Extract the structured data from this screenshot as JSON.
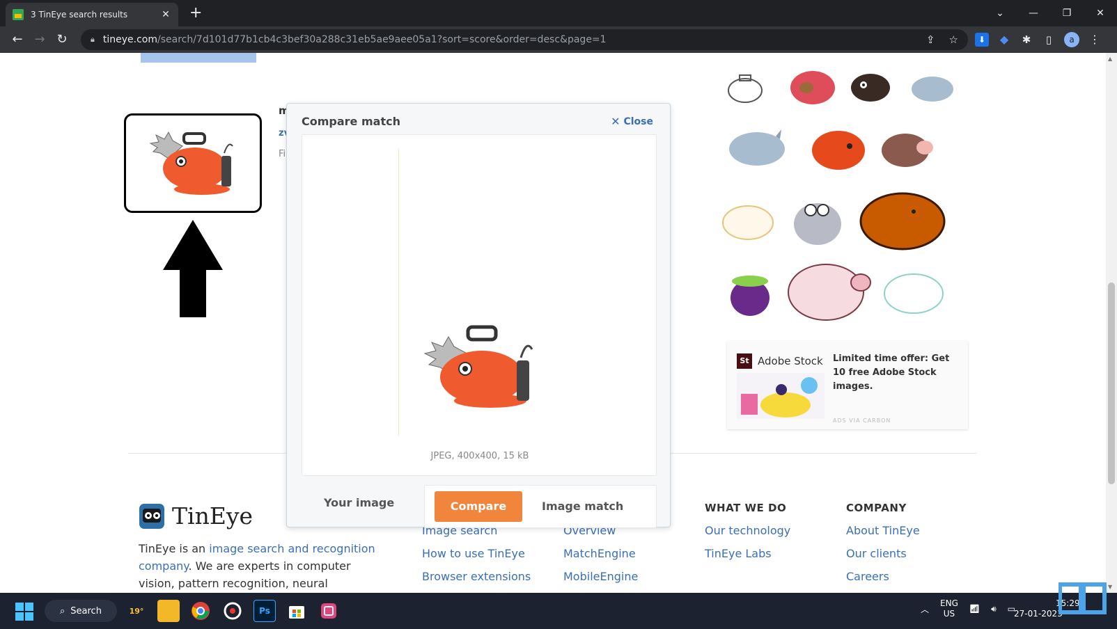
{
  "browser": {
    "tab_title": "3 TinEye search results",
    "tab_close": "✕",
    "new_tab": "+",
    "url_host": "tineye.com",
    "url_path": "/search/7d101d77b1cb4c3bef30a288c31eb5ae9aee05a1?sort=score&order=desc&page=1",
    "profile_initial": "a"
  },
  "results": {
    "snippet_1": "m",
    "snippet_2": "zv",
    "snippet_3": "Fi"
  },
  "ad": {
    "brand_mark": "St",
    "brand": "Adobe Stock",
    "text": "Limited time offer: Get 10 free Adobe Stock images.",
    "via": "ADS VIA CARBON"
  },
  "modal": {
    "title": "Compare match",
    "close_label": "Close",
    "meta": "JPEG, 400x400, 15 kB",
    "tab_your_image": "Your image",
    "tab_compare": "Compare",
    "tab_image_match": "Image match"
  },
  "footer": {
    "logo_text": "TinEye",
    "desc_prefix": "TinEye is an ",
    "desc_link": "image search and recognition company",
    "desc_suffix": ". We are experts in computer vision, pattern recognition, neural",
    "col1": {
      "partial": "Image search",
      "links": [
        "How to use TinEye",
        "Browser extensions"
      ]
    },
    "col2": {
      "partial": "Overview",
      "links": [
        "MatchEngine",
        "MobileEngine"
      ]
    },
    "col3": {
      "head": "WHAT WE DO",
      "links": [
        "Our technology",
        "TinEye Labs"
      ]
    },
    "col4": {
      "head": "COMPANY",
      "links": [
        "About TinEye",
        "Our clients",
        "Careers"
      ]
    }
  },
  "taskbar": {
    "search_label": "Search",
    "weather": "19°",
    "lang_1": "ENG",
    "lang_2": "US",
    "time": "15:29",
    "date": "27-01-2023"
  },
  "colors": {
    "accent_orange": "#f0853b",
    "link_blue": "#3a6fb8"
  }
}
